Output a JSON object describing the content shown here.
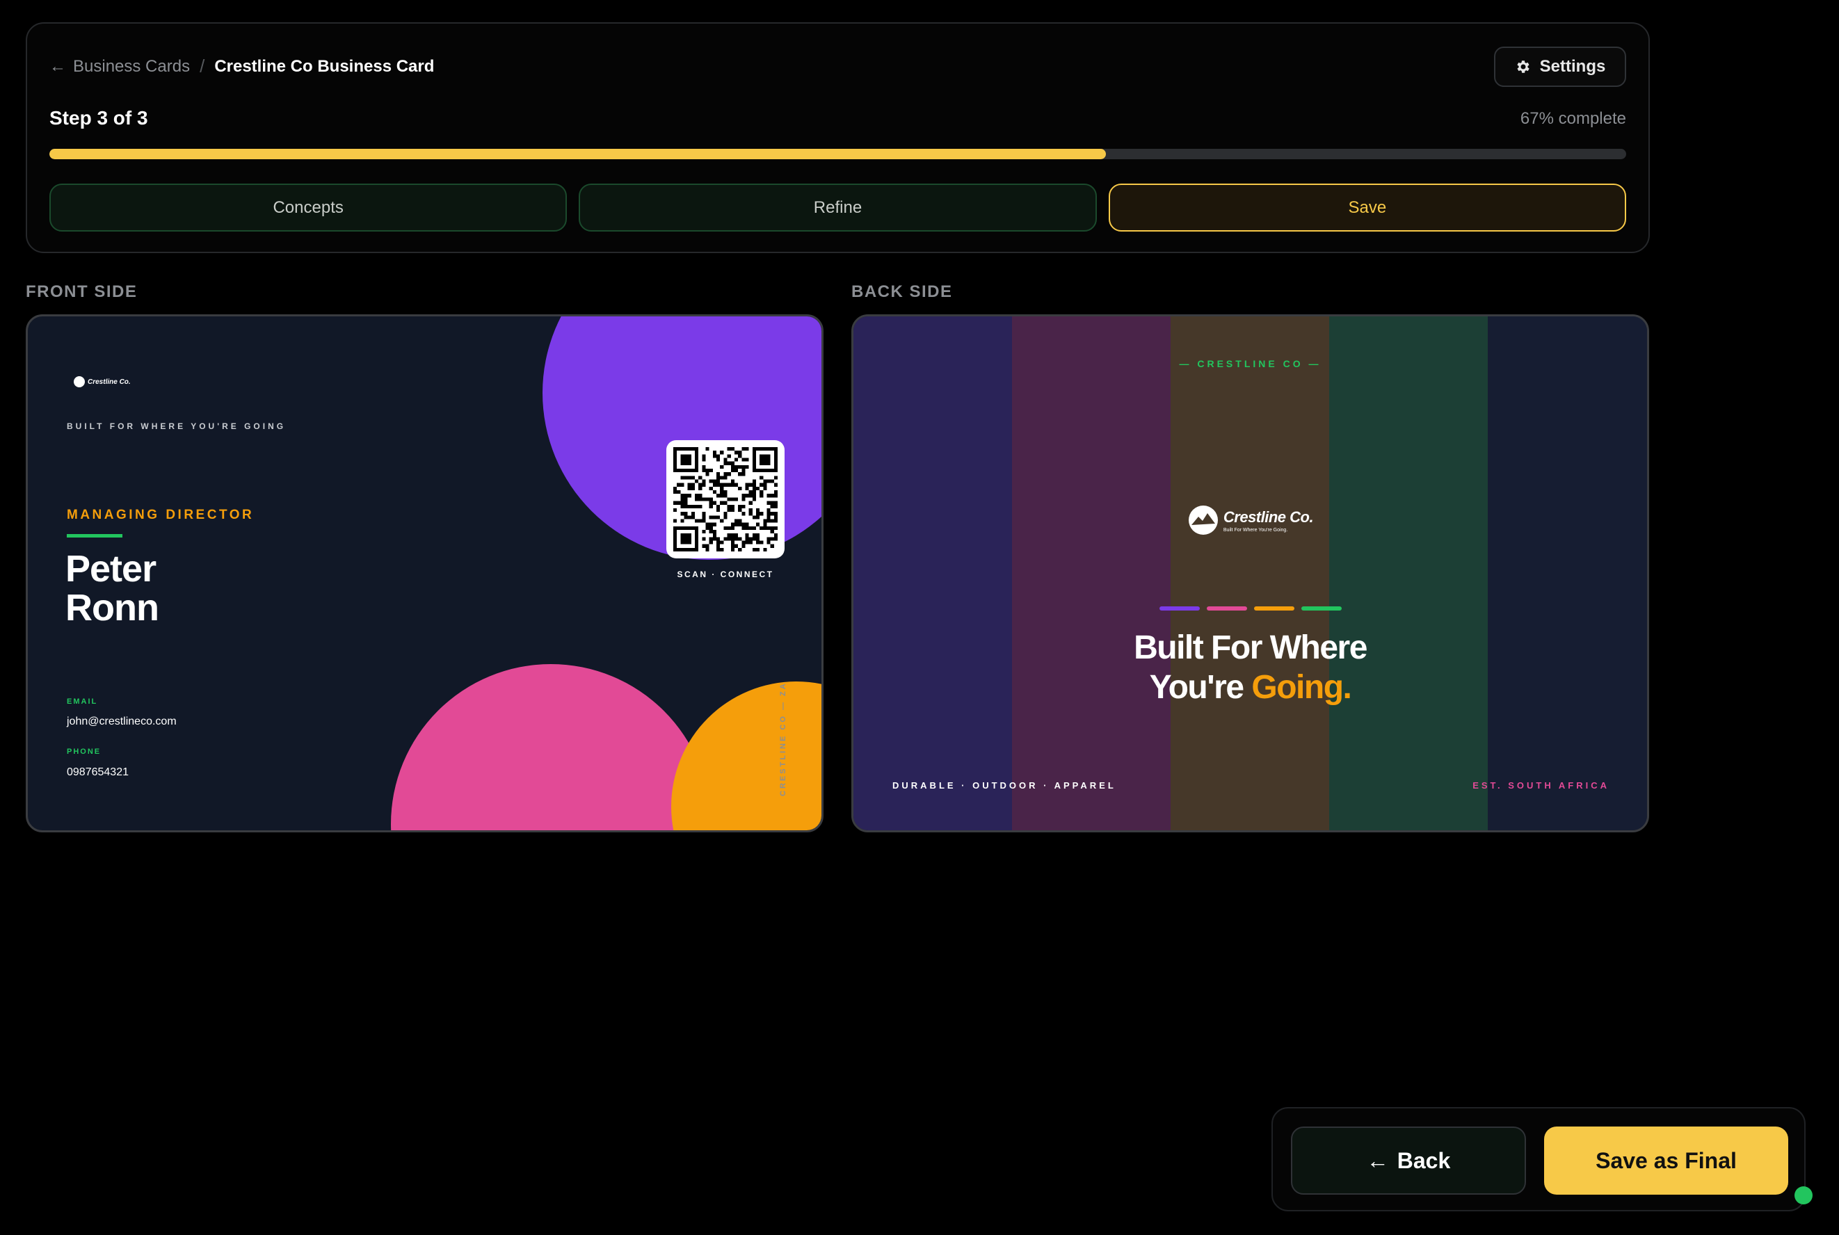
{
  "breadcrumb": {
    "back_label": "Business Cards",
    "separator": "/",
    "current": "Crestline Co Business Card"
  },
  "settings": {
    "label": "Settings",
    "icon": "gear-icon"
  },
  "progress": {
    "step_text": "Step 3 of 3",
    "percent_text": "67% complete",
    "fraction": 0.67,
    "fill_color": "#f7c948"
  },
  "steps": [
    {
      "label": "Concepts",
      "state": "done"
    },
    {
      "label": "Refine",
      "state": "done"
    },
    {
      "label": "Save",
      "state": "active"
    }
  ],
  "front": {
    "section_label": "FRONT SIDE",
    "logo_text": "Crestline Co.",
    "tagline": "BUILT FOR WHERE YOU'RE GOING",
    "role": "MANAGING DIRECTOR",
    "first_name": "Peter",
    "last_name": "Ronn",
    "email_label": "EMAIL",
    "email": "john@crestlineco.com",
    "phone_label": "PHONE",
    "phone": "0987654321",
    "qr_caption": "SCAN · CONNECT",
    "vertical_text": "CRESTLINE CO — ZA"
  },
  "back": {
    "section_label": "BACK SIDE",
    "brand": "— CRESTLINE CO —",
    "logo_name": "Crestline Co.",
    "logo_tag": "Built For Where You're Going.",
    "headline_line1": "Built For Where",
    "headline_line2_start": "You're",
    "headline_accent": "Going.",
    "footer_left": "DURABLE · OUTDOOR · APPAREL",
    "footer_right": "EST. SOUTH AFRICA",
    "bar_colors": [
      "#7b3be8",
      "#e24a96",
      "#f59e0b",
      "#22c55e"
    ]
  },
  "actions": {
    "back_label": "Back",
    "final_label": "Save as Final"
  },
  "colors": {
    "accent": "#f7c948",
    "green": "#22c55e",
    "purple": "#7b3be8",
    "pink": "#e24a96",
    "orange": "#f59e0b"
  }
}
